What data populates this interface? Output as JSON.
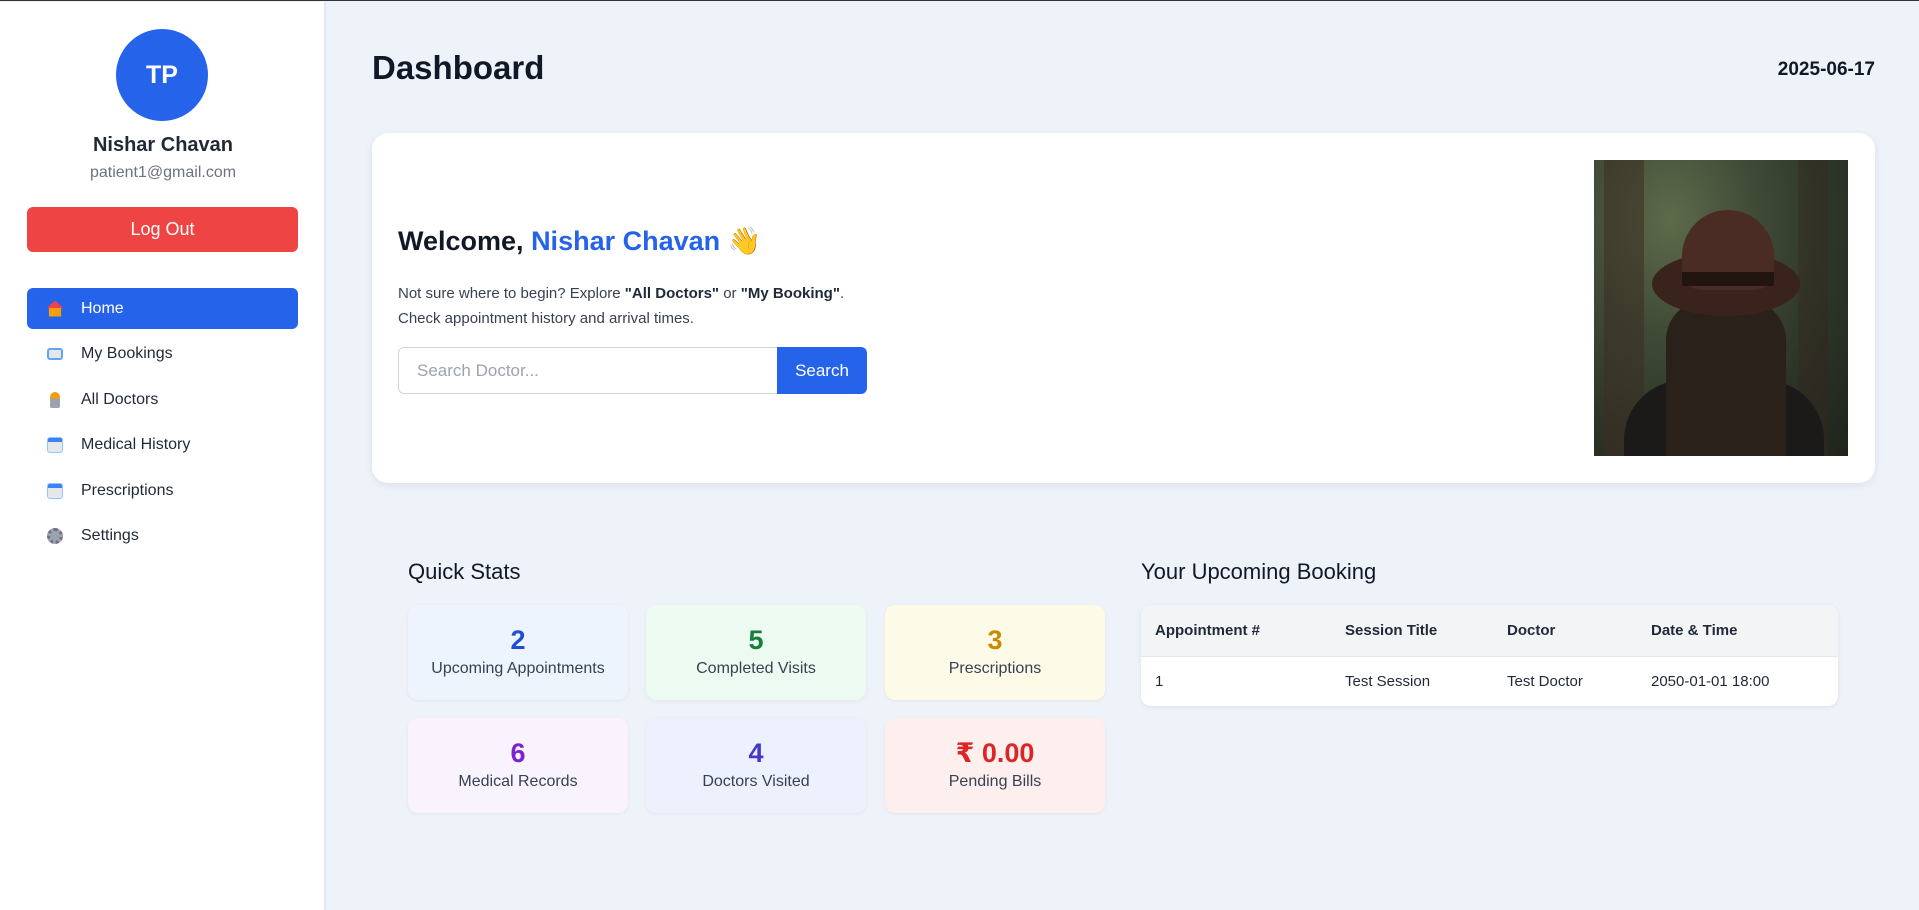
{
  "user": {
    "initials": "TP",
    "name": "Nishar Chavan",
    "email": "patient1@gmail.com"
  },
  "logout_label": "Log Out",
  "nav": [
    {
      "label": "Home",
      "icon": "home-icon",
      "active": true
    },
    {
      "label": "My Bookings",
      "icon": "book-icon"
    },
    {
      "label": "All Doctors",
      "icon": "doctor-icon"
    },
    {
      "label": "Medical History",
      "icon": "calendar-icon"
    },
    {
      "label": "Prescriptions",
      "icon": "calendar-icon"
    },
    {
      "label": "Settings",
      "icon": "gear-icon"
    }
  ],
  "page_title": "Dashboard",
  "date": "2025-06-17",
  "welcome": {
    "prefix": "Welcome, ",
    "name": "Nishar Chavan",
    "emoji": "👋",
    "desc_1": "Not sure where to begin? Explore ",
    "desc_link_1": "\"All Doctors\"",
    "desc_or": " or ",
    "desc_link_2": "\"My Booking\"",
    "desc_end": ".",
    "desc_2": "Check appointment history and arrival times.",
    "search_placeholder": "Search Doctor...",
    "search_label": "Search"
  },
  "quick_stats": {
    "title": "Quick Stats",
    "items": [
      {
        "value": "2",
        "label": "Upcoming Appointments",
        "color": "#1d4ed8",
        "bg": "#eef4fe"
      },
      {
        "value": "5",
        "label": "Completed Visits",
        "color": "#15803d",
        "bg": "#ecfaf2"
      },
      {
        "value": "3",
        "label": "Prescriptions",
        "color": "#ca8a04",
        "bg": "#fefae8"
      },
      {
        "value": "6",
        "label": "Medical Records",
        "color": "#7e22ce",
        "bg": "#f8f3fd"
      },
      {
        "value": "4",
        "label": "Doctors Visited",
        "color": "#4338ca",
        "bg": "#edf1fd"
      },
      {
        "value": "₹ 0.00",
        "label": "Pending Bills",
        "color": "#dc2626",
        "bg": "#feefef"
      }
    ]
  },
  "upcoming": {
    "title": "Your Upcoming Booking",
    "headers": [
      "Appointment #",
      "Session Title",
      "Doctor",
      "Date & Time"
    ],
    "rows": [
      [
        "1",
        "Test Session",
        "Test Doctor",
        "2050-01-01 18:00"
      ]
    ]
  }
}
